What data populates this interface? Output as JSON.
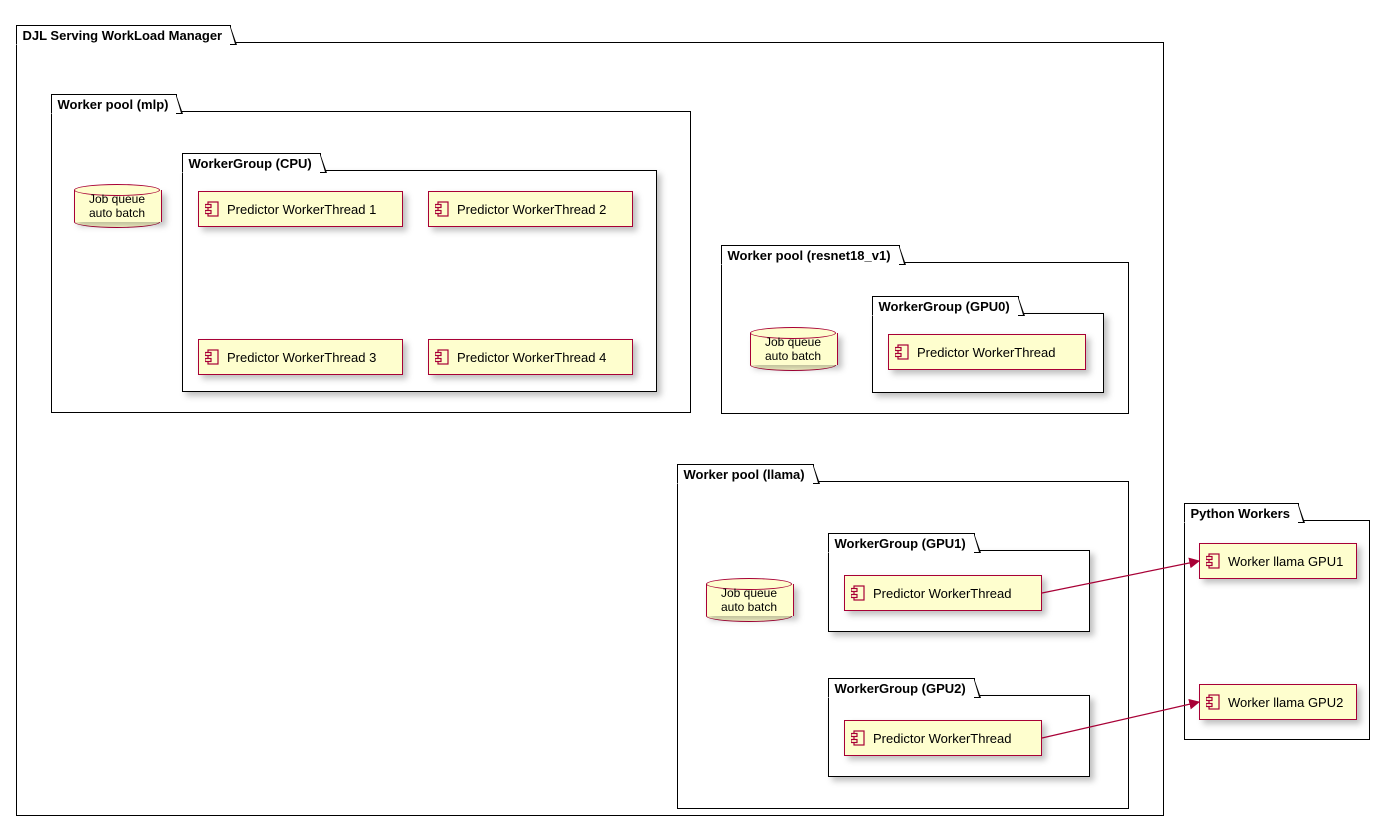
{
  "manager": {
    "title": "DJL Serving WorkLoad Manager"
  },
  "pools": {
    "mlp": {
      "title": "Worker pool (mlp)",
      "queue": {
        "line1": "Job queue",
        "line2": "auto batch"
      },
      "group_cpu": {
        "title": "WorkerGroup (CPU)",
        "threads": {
          "t1": "Predictor WorkerThread 1",
          "t2": "Predictor WorkerThread 2",
          "t3": "Predictor WorkerThread 3",
          "t4": "Predictor WorkerThread 4"
        }
      }
    },
    "resnet": {
      "title": "Worker pool (resnet18_v1)",
      "queue": {
        "line1": "Job queue",
        "line2": "auto batch"
      },
      "group_gpu0": {
        "title": "WorkerGroup (GPU0)",
        "thread": "Predictor WorkerThread"
      }
    },
    "llama": {
      "title": "Worker pool (llama)",
      "queue": {
        "line1": "Job queue",
        "line2": "auto batch"
      },
      "group_gpu1": {
        "title": "WorkerGroup (GPU1)",
        "thread": "Predictor WorkerThread"
      },
      "group_gpu2": {
        "title": "WorkerGroup (GPU2)",
        "thread": "Predictor WorkerThread"
      }
    }
  },
  "python_workers": {
    "title": "Python Workers",
    "gpu1": "Worker llama GPU1",
    "gpu2": "Worker llama GPU2"
  },
  "colors": {
    "component_fill": "#FEFECE",
    "component_border": "#A80036"
  }
}
